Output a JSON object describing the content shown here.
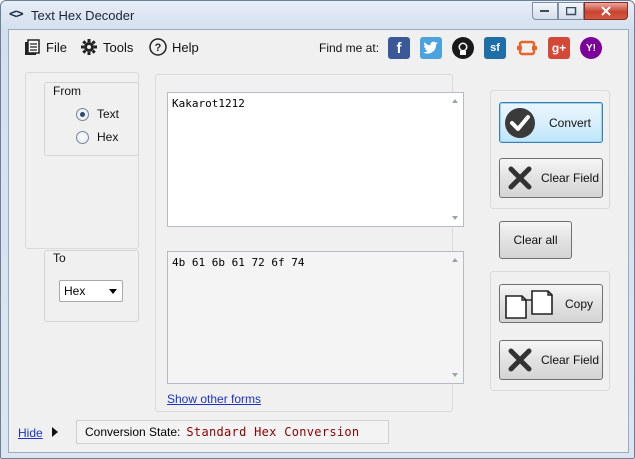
{
  "window": {
    "title": "Text Hex Decoder",
    "icon_glyph": "<>"
  },
  "menu": {
    "file_label": "File",
    "tools_label": "Tools",
    "help_label": "Help",
    "findme_label": "Find me at:"
  },
  "social": [
    {
      "name": "facebook",
      "glyph": "f",
      "color": "#3b5998"
    },
    {
      "name": "twitter",
      "glyph": "t",
      "color": "#4aa3df"
    },
    {
      "name": "github",
      "glyph": "",
      "color": "#1a1a1a"
    },
    {
      "name": "sourceforge",
      "glyph": "sf",
      "color": "#1e6ea8"
    },
    {
      "name": "codeplex",
      "glyph": "",
      "color": "#e8642c"
    },
    {
      "name": "googleplus",
      "glyph": "g+",
      "color": "#d34836"
    },
    {
      "name": "yahoo",
      "glyph": "Y!",
      "color": "#7b0099"
    }
  ],
  "from_group": {
    "label": "From",
    "options": [
      "Text",
      "Hex"
    ],
    "selected": "Text"
  },
  "to_group": {
    "label": "To",
    "selected_value": "Hex"
  },
  "input_text": "Kakarot1212",
  "output_text": "4b 61 6b 61 72 6f 74",
  "show_other_forms": "Show other forms",
  "buttons": {
    "convert": "Convert",
    "clear_field_top": "Clear Field",
    "clear_all": "Clear all",
    "copy": "Copy",
    "clear_field_bottom": "Clear Field"
  },
  "status": {
    "hide_label": "Hide",
    "state_label": "Conversion State:",
    "state_value": "Standard Hex Conversion"
  }
}
